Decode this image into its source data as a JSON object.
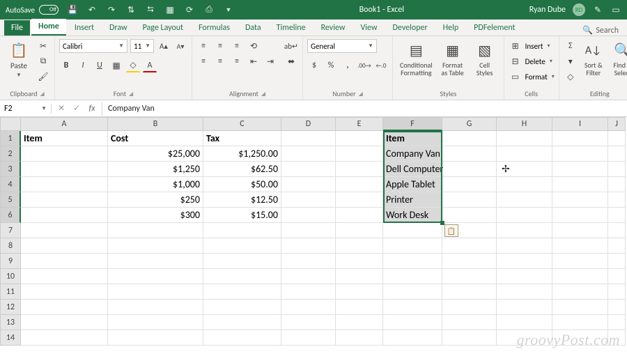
{
  "titlebar": {
    "autosave_label": "AutoSave",
    "autosave_state": "Off",
    "doc_title": "Book1 - Excel",
    "username": "Ryan Dube",
    "avatar_initials": "RD"
  },
  "tabs": {
    "items": [
      "File",
      "Home",
      "Insert",
      "Draw",
      "Page Layout",
      "Formulas",
      "Data",
      "Timeline",
      "Review",
      "View",
      "Developer",
      "Help",
      "PDFelement"
    ],
    "active": "Home",
    "search_label": "Search"
  },
  "ribbon": {
    "clipboard": {
      "label": "Clipboard",
      "paste": "Paste"
    },
    "font": {
      "label": "Font",
      "name": "Calibri",
      "size": "11"
    },
    "alignment": {
      "label": "Alignment"
    },
    "number": {
      "label": "Number",
      "format": "General"
    },
    "styles": {
      "label": "Styles",
      "cond": "Conditional Formatting",
      "table": "Format as Table",
      "cell": "Cell Styles"
    },
    "cells": {
      "label": "Cells",
      "insert": "Insert",
      "delete": "Delete",
      "format": "Format"
    },
    "editing": {
      "label": "Editing",
      "sort": "Sort & Filter",
      "find": "Find & Select"
    }
  },
  "fbar": {
    "name": "F2",
    "formula": "Company Van"
  },
  "columns": [
    "A",
    "B",
    "C",
    "D",
    "E",
    "F",
    "G",
    "H",
    "I",
    "J"
  ],
  "row_count": 14,
  "cells": {
    "A1": "Item",
    "B1": "Cost",
    "C1": "Tax",
    "F1": "Item",
    "B2": "$25,000",
    "C2": "$1,250.00",
    "F2": "Company Van",
    "B3": "$1,250",
    "C3": "$62.50",
    "F3": "Dell Computer",
    "B4": "$1,000",
    "C4": "$50.00",
    "F4": "Apple Tablet",
    "B5": "$250",
    "C5": "$12.50",
    "F5": "Printer",
    "B6": "$300",
    "C6": "$15.00",
    "F6": "Work Desk"
  },
  "watermark": "groovyPost.com"
}
